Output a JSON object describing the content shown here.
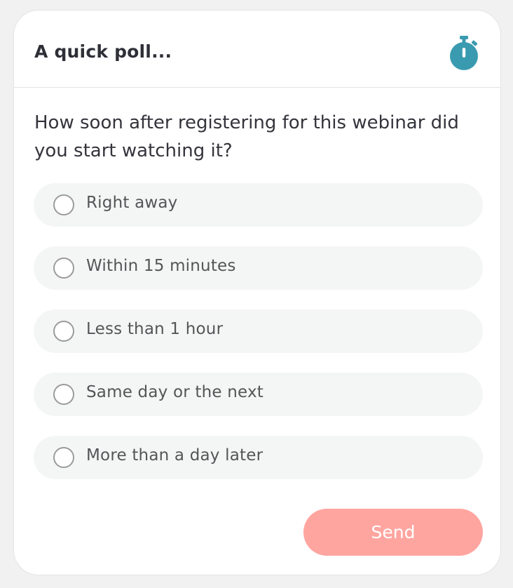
{
  "poll": {
    "title": "A quick poll...",
    "timer_icon": "stopwatch-icon",
    "question": "How soon after registering for this webinar did you start watching it?",
    "options": [
      {
        "label": "Right away",
        "selected": false
      },
      {
        "label": "Within 15 minutes",
        "selected": false
      },
      {
        "label": "Less than 1 hour",
        "selected": false
      },
      {
        "label": "Same day or the next",
        "selected": false
      },
      {
        "label": "More than a day later",
        "selected": false
      }
    ],
    "send_label": "Send"
  },
  "colors": {
    "accent": "#3a9bb0",
    "send_button": "#ffa5a0",
    "option_bg": "#f4f6f5",
    "text": "#34343c"
  }
}
